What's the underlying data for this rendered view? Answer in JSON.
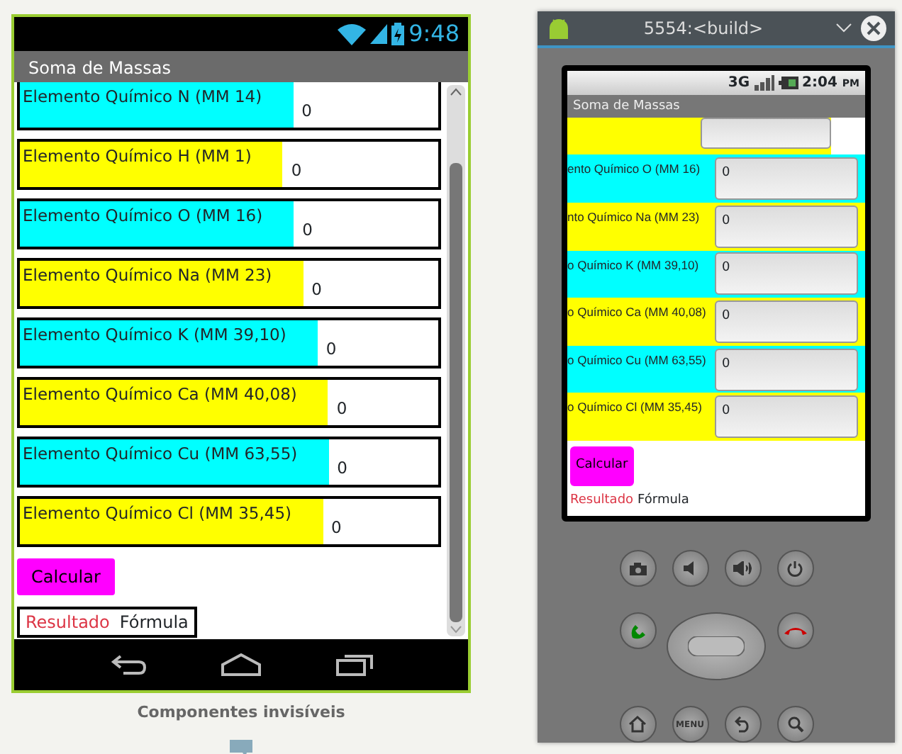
{
  "designer": {
    "phone": {
      "status_bar": {
        "time": "9:48"
      },
      "title": "Soma de Massas",
      "rows": [
        {
          "label": "Elemento Químico N (MM 14)",
          "value": "0",
          "color": "#00ffff"
        },
        {
          "label": "Elemento Químico H (MM 1)",
          "value": "0",
          "color": "#ffff00"
        },
        {
          "label": "Elemento Químico O (MM 16)",
          "value": "0",
          "color": "#00ffff"
        },
        {
          "label": "Elemento Químico Na (MM 23)",
          "value": "0",
          "color": "#ffff00"
        },
        {
          "label": "Elemento Químico K (MM 39,10)",
          "value": "0",
          "color": "#00ffff"
        },
        {
          "label": "Elemento Químico Ca (MM 40,08)",
          "value": "0",
          "color": "#ffff00"
        },
        {
          "label": "Elemento Químico Cu (MM 63,55)",
          "value": "0",
          "color": "#00ffff"
        },
        {
          "label": "Elemento Químico Cl (MM 35,45)",
          "value": "0",
          "color": "#ffff00"
        }
      ],
      "button": "Calcular",
      "result": {
        "label": "Resultado",
        "formula": "Fórmula"
      }
    },
    "invisible_components_label": "Componentes invisíveis"
  },
  "emulator": {
    "window_title": "5554:<build>",
    "phone": {
      "status_bar": {
        "network": "3G",
        "time": "2:04",
        "ampm": "PM"
      },
      "title": "Soma de Massas",
      "rows": [
        {
          "color": "#ffff00"
        },
        {
          "label": "ento Químico O (MM 16)",
          "value": "0",
          "color": "#00ffff"
        },
        {
          "label": "nto Químico Na (MM 23)",
          "value": "0",
          "color": "#ffff00"
        },
        {
          "label": "o Químico K (MM 39,10)",
          "value": "0",
          "color": "#00ffff"
        },
        {
          "label": "o Químico Ca (MM 40,08)",
          "value": "0",
          "color": "#ffff00"
        },
        {
          "label": "o Químico Cu (MM 63,55)",
          "value": "0",
          "color": "#00ffff"
        },
        {
          "label": "o Químico Cl (MM 35,45)",
          "value": "0",
          "color": "#ffff00"
        }
      ],
      "button": "Calcular",
      "result": {
        "label": "Resultado",
        "formula": "Fórmula"
      }
    },
    "menu_key": "MENU"
  }
}
